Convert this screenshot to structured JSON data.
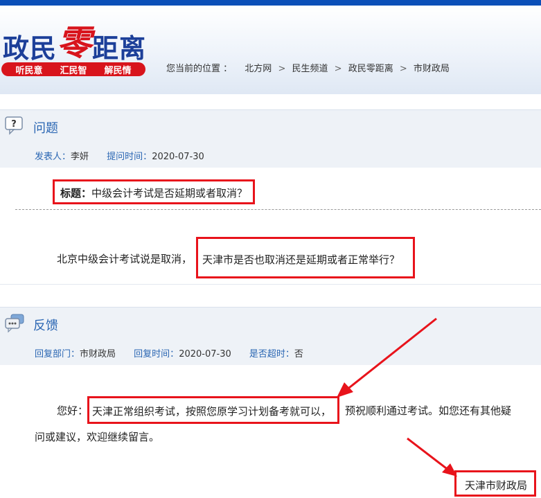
{
  "header": {
    "logo_part1": "政民",
    "logo_red": "零",
    "logo_part2": "距离",
    "slogans": [
      "听民意",
      "汇民智",
      "解民情"
    ]
  },
  "breadcrumb": {
    "prefix": "您当前的位置 ：",
    "items": [
      "北方网",
      "民生频道",
      "政民零距离",
      "市财政局"
    ],
    "separator": ">"
  },
  "question": {
    "section_title": "问题",
    "poster_label": "发表人：",
    "poster": "李妍",
    "time_label": "提问时间：",
    "time": "2020-07-30",
    "title_label": "标题：",
    "title": "中级会计考试是否延期或者取消？",
    "body_prefix": "北京中级会计考试说是取消，",
    "body_highlight": "天津市是否也取消还是延期或者正常举行？"
  },
  "feedback": {
    "section_title": "反馈",
    "dept_label": "回复部门：",
    "dept": "市财政局",
    "time_label": "回复时间：",
    "time": "2020-07-30",
    "overdue_label": "是否超时：",
    "overdue": "否",
    "greeting": "您好：",
    "highlight": "天津正常组织考试，按照您原学习计划备考就可以，",
    "rest_line1": "预祝顺利通过考试。如您还有其他疑",
    "line2": "问或建议，欢迎继续留言。",
    "signature": "天津市财政局"
  },
  "colors": {
    "brand_blue": "#0b4fb8",
    "link_blue": "#2a66b3",
    "highlight_red": "#e8131b"
  }
}
